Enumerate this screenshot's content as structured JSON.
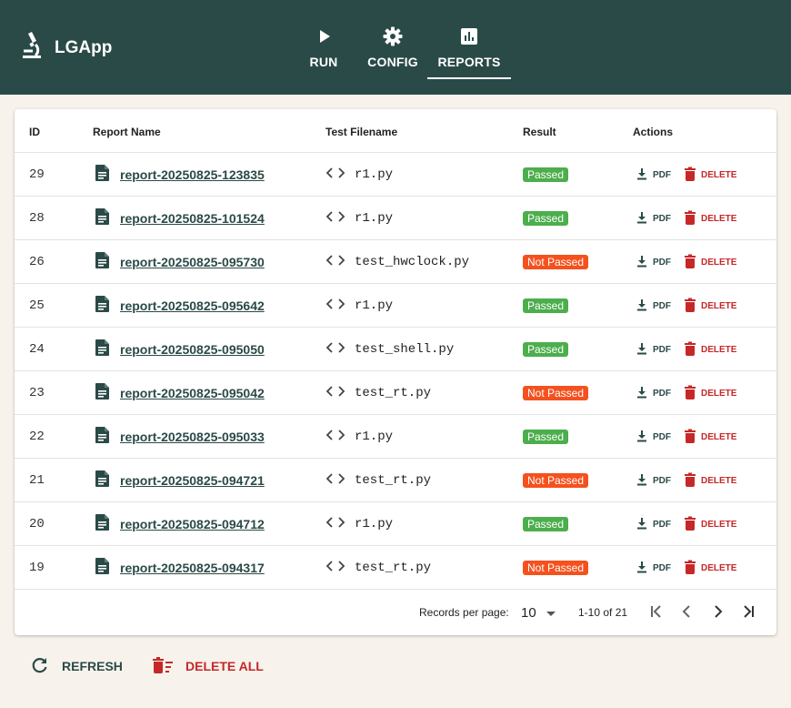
{
  "app": {
    "title": "LGApp",
    "logo_icon": "microscope-icon"
  },
  "nav": {
    "tabs": [
      {
        "label": "RUN",
        "icon": "play-icon"
      },
      {
        "label": "CONFIG",
        "icon": "gear-icon"
      },
      {
        "label": "REPORTS",
        "icon": "chart-icon",
        "active": true
      }
    ]
  },
  "table": {
    "headers": {
      "id": "ID",
      "name": "Report Name",
      "file": "Test Filename",
      "result": "Result",
      "actions": "Actions"
    },
    "pdf_label": "PDF",
    "delete_label": "DELETE",
    "rows": [
      {
        "id": "29",
        "name": "report-20250825-123835",
        "file": "r1.py",
        "result": "Passed"
      },
      {
        "id": "28",
        "name": "report-20250825-101524",
        "file": "r1.py",
        "result": "Passed"
      },
      {
        "id": "26",
        "name": "report-20250825-095730",
        "file": "test_hwclock.py",
        "result": "Not Passed"
      },
      {
        "id": "25",
        "name": "report-20250825-095642",
        "file": "r1.py",
        "result": "Passed"
      },
      {
        "id": "24",
        "name": "report-20250825-095050",
        "file": "test_shell.py",
        "result": "Passed"
      },
      {
        "id": "23",
        "name": "report-20250825-095042",
        "file": "test_rt.py",
        "result": "Not Passed"
      },
      {
        "id": "22",
        "name": "report-20250825-095033",
        "file": "r1.py",
        "result": "Passed"
      },
      {
        "id": "21",
        "name": "report-20250825-094721",
        "file": "test_rt.py",
        "result": "Not Passed"
      },
      {
        "id": "20",
        "name": "report-20250825-094712",
        "file": "r1.py",
        "result": "Passed"
      },
      {
        "id": "19",
        "name": "report-20250825-094317",
        "file": "test_rt.py",
        "result": "Not Passed"
      }
    ]
  },
  "pagination": {
    "records_per_page_label": "Records per page:",
    "records_per_page": "10",
    "range": "1-10 of 21"
  },
  "actions": {
    "refresh_label": "REFRESH",
    "delete_all_label": "DELETE ALL"
  },
  "colors": {
    "primary": "#2a4a48",
    "danger": "#c62828",
    "passed": "#4cae4c",
    "not_passed": "#f4511e",
    "background": "#f7f2ec"
  }
}
